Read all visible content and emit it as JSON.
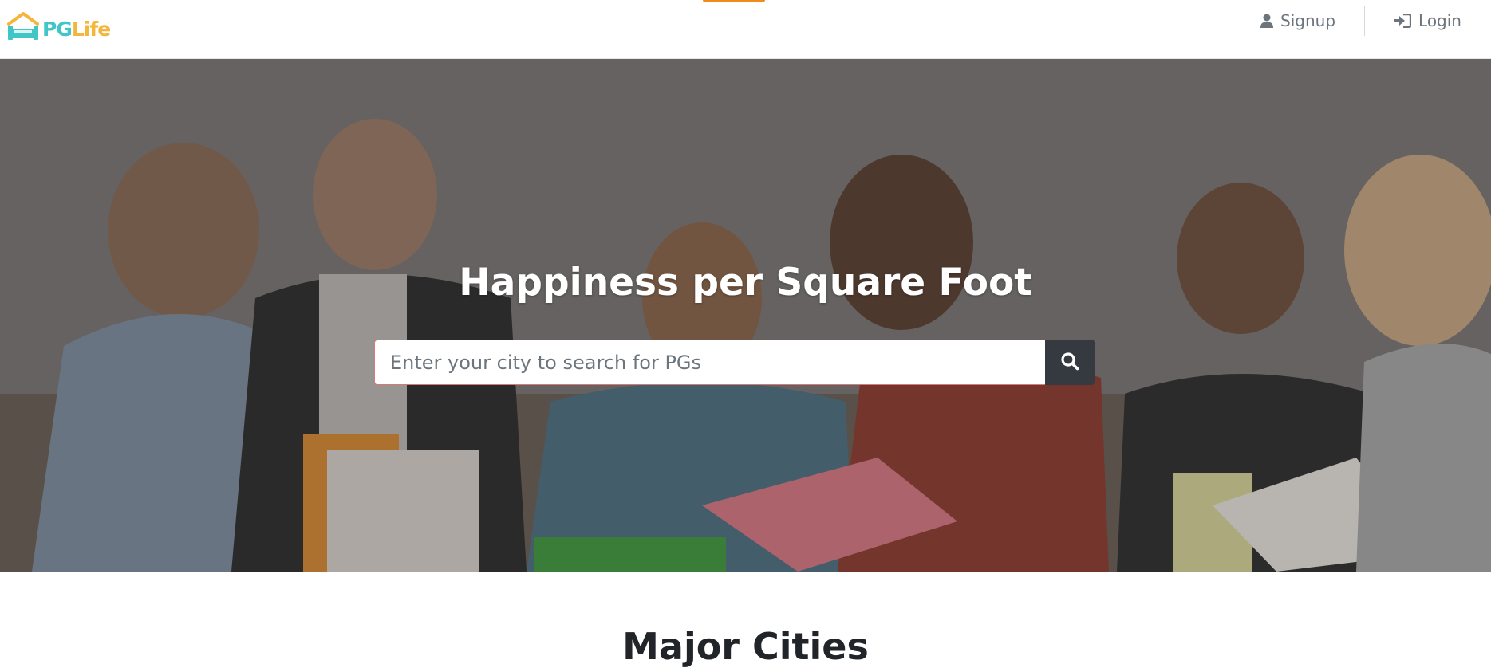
{
  "brand": {
    "name_part1": "PG",
    "name_part2": "Life"
  },
  "nav": {
    "signup_label": "Signup",
    "login_label": "Login",
    "signup_icon": "user-icon",
    "login_icon": "sign-in-icon"
  },
  "hero": {
    "title": "Happiness per Square Foot",
    "search_placeholder": "Enter your city to search for PGs",
    "search_value": "",
    "search_icon": "search-icon"
  },
  "sections": {
    "major_cities_title": "Major Cities"
  },
  "colors": {
    "brand_teal": "#40c6c6",
    "brand_yellow": "#f5b53a",
    "search_button": "#343a40",
    "nav_text": "#6c757d",
    "accent_tab": "#f28a1b"
  }
}
